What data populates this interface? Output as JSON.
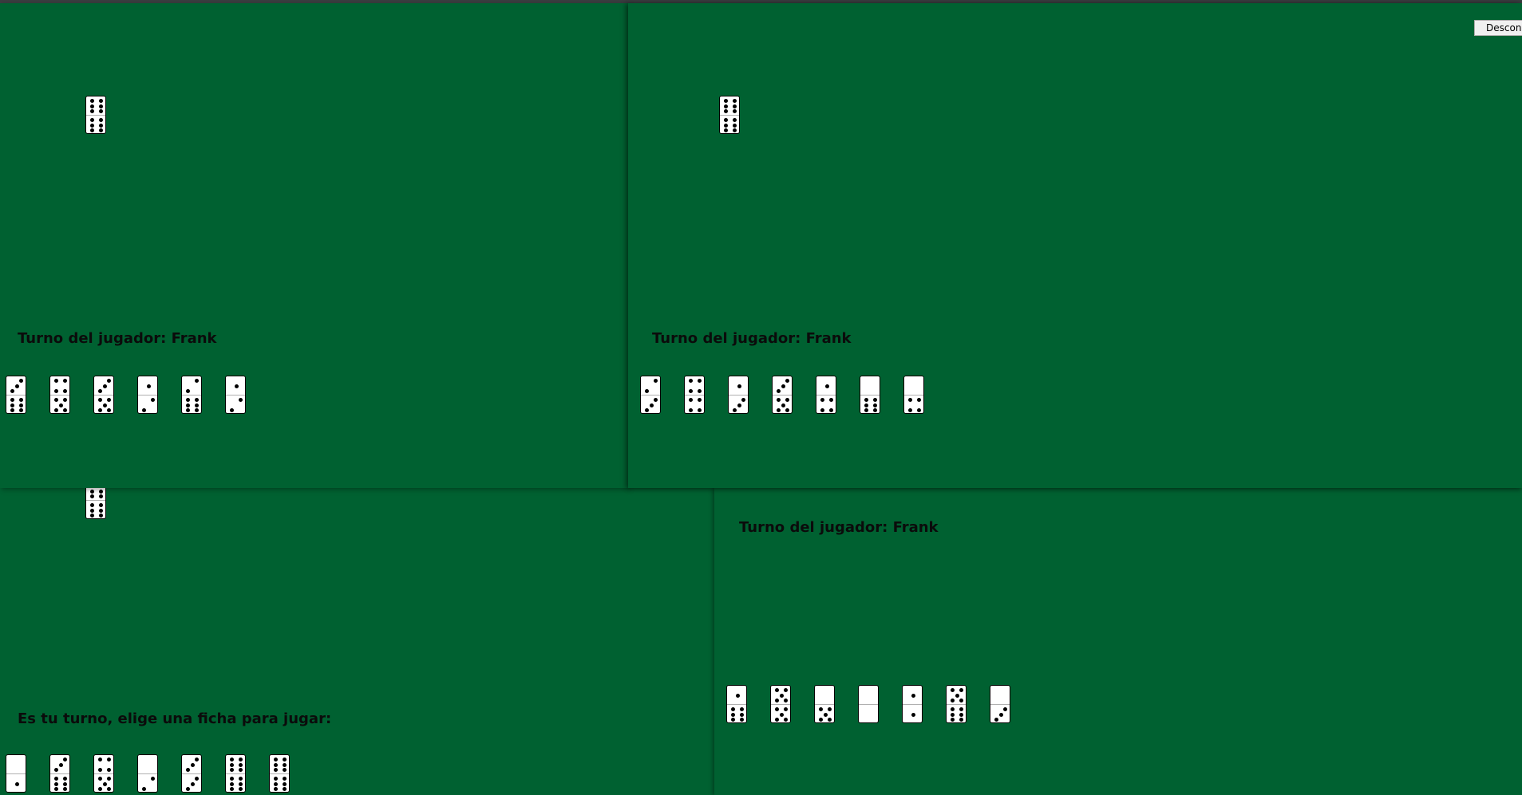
{
  "windows": {
    "top_left": {
      "status": "Turno del jugador: Frank",
      "board_tile": [
        6,
        6
      ],
      "hand": [
        [
          3,
          6
        ],
        [
          4,
          5
        ],
        [
          3,
          5
        ],
        [
          1,
          2
        ],
        [
          2,
          6
        ],
        [
          1,
          2
        ]
      ]
    },
    "top_right": {
      "status": "Turno del jugador: Frank",
      "disconnect_label": "Desconectar",
      "board_tile": [
        6,
        6
      ],
      "hand": [
        [
          2,
          3
        ],
        [
          4,
          4
        ],
        [
          1,
          3
        ],
        [
          3,
          5
        ],
        [
          1,
          4
        ],
        [
          0,
          6
        ],
        [
          0,
          4
        ]
      ]
    },
    "bottom_left": {
      "status": "Es tu turno, elige una ficha para jugar:",
      "board_tile": [
        6,
        6
      ],
      "hand": [
        [
          0,
          1
        ],
        [
          3,
          6
        ],
        [
          4,
          5
        ],
        [
          0,
          2
        ],
        [
          3,
          3
        ],
        [
          6,
          6
        ],
        [
          6,
          6
        ]
      ]
    },
    "bottom_right": {
      "status": "Turno del jugador: Frank",
      "hand": [
        [
          1,
          6
        ],
        [
          5,
          5
        ],
        [
          0,
          5
        ],
        [
          0,
          0
        ],
        [
          1,
          1
        ],
        [
          5,
          6
        ],
        [
          0,
          3
        ]
      ]
    }
  },
  "colors": {
    "felt": "#006131",
    "tile": "#ffffff",
    "pip": "#000000"
  }
}
